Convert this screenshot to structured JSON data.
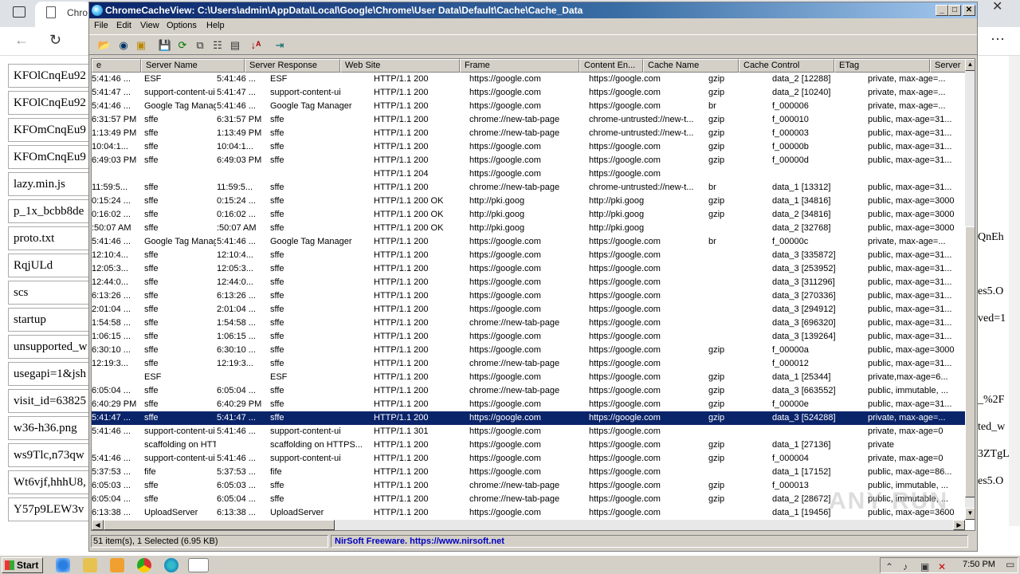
{
  "browser": {
    "tab_title": "Chro"
  },
  "page_left_items": [
    "KFOlCnqEu92",
    "KFOlCnqEu92",
    "KFOmCnqEu9",
    "KFOmCnqEu9",
    "lazy.min.js",
    "p_1x_bcbb8de",
    "proto.txt",
    "RqjULd",
    "scs",
    "startup",
    "unsupported_w",
    "usegapi=1&jsh",
    "visit_id=63825",
    "w36-h36.png",
    "ws9Tlc,n73qw",
    "Wt6vjf,hhhU8,",
    "Y57p9LEW3v"
  ],
  "page_right_items": [
    "",
    "",
    "",
    "",
    "",
    "",
    "QnEh",
    "",
    "es5.O",
    "ved=1",
    "",
    "",
    "_%2F",
    "ted_w",
    "3ZTgL",
    "es5.O",
    ""
  ],
  "app": {
    "title": "ChromeCacheView:  C:\\Users\\admin\\AppData\\Local\\Google\\Chrome\\User Data\\Default\\Cache\\Cache_Data",
    "menu": [
      "File",
      "Edit",
      "View",
      "Options",
      "Help"
    ],
    "columns": [
      "e",
      "Server Name",
      "Server Response",
      "Web Site",
      "Frame",
      "Content En...",
      "Cache Name",
      "Cache Control",
      "ETag",
      "Server"
    ],
    "rows": [
      [
        "5:41:46 ...",
        "ESF",
        "5:41:46 ...",
        "ESF",
        "HTTP/1.1 200",
        "https://google.com",
        "https://google.com",
        "gzip",
        "data_2  [12288]",
        "private, max-age=..."
      ],
      [
        "5:41:47 ...",
        "support-content-ui",
        "5:41:47 ...",
        "support-content-ui",
        "HTTP/1.1 200",
        "https://google.com",
        "https://google.com",
        "gzip",
        "data_2  [10240]",
        "private, max-age=..."
      ],
      [
        "5:41:46 ...",
        "Google Tag Manag",
        "5:41:46 ...",
        "Google Tag Manager",
        "HTTP/1.1 200",
        "https://google.com",
        "https://google.com",
        "br",
        "f_000006",
        "private, max-age=..."
      ],
      [
        "6:31:57 PM",
        "sffe",
        "6:31:57 PM",
        "sffe",
        "HTTP/1.1 200",
        "chrome://new-tab-page",
        "chrome-untrusted://new-t...",
        "gzip",
        "f_000010",
        "public, max-age=31..."
      ],
      [
        "1:13:49 PM",
        "sffe",
        "1:13:49 PM",
        "sffe",
        "HTTP/1.1 200",
        "chrome://new-tab-page",
        "chrome-untrusted://new-t...",
        "gzip",
        "f_000003",
        "public, max-age=31..."
      ],
      [
        "10:04:1...",
        "sffe",
        "10:04:1...",
        "sffe",
        "HTTP/1.1 200",
        "https://google.com",
        "https://google.com",
        "gzip",
        "f_00000b",
        "public, max-age=31..."
      ],
      [
        "6:49:03 PM",
        "sffe",
        "6:49:03 PM",
        "sffe",
        "HTTP/1.1 200",
        "https://google.com",
        "https://google.com",
        "gzip",
        "f_00000d",
        "public, max-age=31..."
      ],
      [
        "",
        "",
        "",
        "",
        "HTTP/1.1 204",
        "https://google.com",
        "https://google.com",
        "",
        "",
        ""
      ],
      [
        "11:59:5...",
        "sffe",
        "11:59:5...",
        "sffe",
        "HTTP/1.1 200",
        "chrome://new-tab-page",
        "chrome-untrusted://new-t...",
        "br",
        "data_1  [13312]",
        "public, max-age=31..."
      ],
      [
        "0:15:24 ...",
        "sffe",
        "0:15:24 ...",
        "sffe",
        "HTTP/1.1 200 OK",
        "http://pki.goog",
        "http://pki.goog",
        "gzip",
        "data_1  [34816]",
        "public, max-age=3000"
      ],
      [
        "0:16:02 ...",
        "sffe",
        "0:16:02 ...",
        "sffe",
        "HTTP/1.1 200 OK",
        "http://pki.goog",
        "http://pki.goog",
        "gzip",
        "data_2  [34816]",
        "public, max-age=3000"
      ],
      [
        ":50:07 AM",
        "sffe",
        ":50:07 AM",
        "sffe",
        "HTTP/1.1 200 OK",
        "http://pki.goog",
        "http://pki.goog",
        "",
        "data_2  [32768]",
        "public, max-age=3000"
      ],
      [
        "5:41:46 ...",
        "Google Tag Manag",
        "5:41:46 ...",
        "Google Tag Manager",
        "HTTP/1.1 200",
        "https://google.com",
        "https://google.com",
        "br",
        "f_00000c",
        "private, max-age=..."
      ],
      [
        "12:10:4...",
        "sffe",
        "12:10:4...",
        "sffe",
        "HTTP/1.1 200",
        "https://google.com",
        "https://google.com",
        "",
        "data_3  [335872]",
        "public, max-age=31..."
      ],
      [
        "12:05:3...",
        "sffe",
        "12:05:3...",
        "sffe",
        "HTTP/1.1 200",
        "https://google.com",
        "https://google.com",
        "",
        "data_3  [253952]",
        "public, max-age=31..."
      ],
      [
        "12:44:0...",
        "sffe",
        "12:44:0...",
        "sffe",
        "HTTP/1.1 200",
        "https://google.com",
        "https://google.com",
        "",
        "data_3  [311296]",
        "public, max-age=31..."
      ],
      [
        "6:13:26 ...",
        "sffe",
        "6:13:26 ...",
        "sffe",
        "HTTP/1.1 200",
        "https://google.com",
        "https://google.com",
        "",
        "data_3  [270336]",
        "public, max-age=31..."
      ],
      [
        "2:01:04 ...",
        "sffe",
        "2:01:04 ...",
        "sffe",
        "HTTP/1.1 200",
        "https://google.com",
        "https://google.com",
        "",
        "data_3  [294912]",
        "public, max-age=31..."
      ],
      [
        "1:54:58 ...",
        "sffe",
        "1:54:58 ...",
        "sffe",
        "HTTP/1.1 200",
        "chrome://new-tab-page",
        "https://google.com",
        "",
        "data_3  [696320]",
        "public, max-age=31..."
      ],
      [
        "1:06:15 ...",
        "sffe",
        "1:06:15 ...",
        "sffe",
        "HTTP/1.1 200",
        "https://google.com",
        "https://google.com",
        "",
        "data_3  [139264]",
        "public, max-age=31..."
      ],
      [
        "6:30:10 ...",
        "sffe",
        "6:30:10 ...",
        "sffe",
        "HTTP/1.1 200",
        "https://google.com",
        "https://google.com",
        "gzip",
        "f_00000a",
        "public, max-age=3000"
      ],
      [
        "12:19:3...",
        "sffe",
        "12:19:3...",
        "sffe",
        "HTTP/1.1 200",
        "chrome://new-tab-page",
        "https://google.com",
        "",
        "f_000012",
        "public, max-age=31..."
      ],
      [
        "",
        "ESF",
        "",
        "ESF",
        "HTTP/1.1 200",
        "https://google.com",
        "https://google.com",
        "gzip",
        "data_1  [25344]",
        "private,max-age=6..."
      ],
      [
        "6:05:04 ...",
        "sffe",
        "6:05:04 ...",
        "sffe",
        "HTTP/1.1 200",
        "chrome://new-tab-page",
        "https://google.com",
        "gzip",
        "data_3  [663552]",
        "public, immutable, ..."
      ],
      [
        "6:40:29 PM",
        "sffe",
        "6:40:29 PM",
        "sffe",
        "HTTP/1.1 200",
        "https://google.com",
        "https://google.com",
        "gzip",
        "f_00000e",
        "public, max-age=31..."
      ],
      [
        "5:41:47 ...",
        "sffe",
        "5:41:47 ...",
        "sffe",
        "HTTP/1.1 200",
        "https://google.com",
        "https://google.com",
        "gzip",
        "data_3  [524288]",
        "private, max-age=..."
      ],
      [
        "5:41:46 ...",
        "support-content-ui",
        "5:41:46 ...",
        "support-content-ui",
        "HTTP/1.1 301",
        "https://google.com",
        "https://google.com",
        "",
        "",
        "private, max-age=0"
      ],
      [
        "",
        "scaffolding on HTTI",
        "",
        "scaffolding on HTTPS...",
        "HTTP/1.1 200",
        "https://google.com",
        "https://google.com",
        "gzip",
        "data_1  [27136]",
        "private"
      ],
      [
        "5:41:46 ...",
        "support-content-ui",
        "5:41:46 ...",
        "support-content-ui",
        "HTTP/1.1 200",
        "https://google.com",
        "https://google.com",
        "gzip",
        "f_000004",
        "private, max-age=0"
      ],
      [
        "5:37:53 ...",
        "fife",
        "5:37:53 ...",
        "fife",
        "HTTP/1.1 200",
        "https://google.com",
        "https://google.com",
        "",
        "data_1  [17152]",
        "public, max-age=86..."
      ],
      [
        "6:05:03 ...",
        "sffe",
        "6:05:03 ...",
        "sffe",
        "HTTP/1.1 200",
        "chrome://new-tab-page",
        "https://google.com",
        "gzip",
        "f_000013",
        "public, immutable, ..."
      ],
      [
        "6:05:04 ...",
        "sffe",
        "6:05:04 ...",
        "sffe",
        "HTTP/1.1 200",
        "chrome://new-tab-page",
        "https://google.com",
        "gzip",
        "data_2  [28672]",
        "public, immutable, ..."
      ],
      [
        "6:13:38 ...",
        "UploadServer",
        "6:13:38 ...",
        "UploadServer",
        "HTTP/1.1 200",
        "https://google.com",
        "https://google.com",
        "",
        "data_1  [19456]",
        "public, max-age=3600"
      ]
    ],
    "selected_row": 25,
    "status_left": "51 item(s), 1 Selected  (6.95 KB)",
    "status_right": "NirSoft Freeware. https://www.nirsoft.net"
  },
  "taskbar": {
    "start_label": "Start",
    "clock": "7:50 PM"
  },
  "watermark": "ANY RUN",
  "colors": {
    "selection": "#0a246a",
    "link_blue": "#0000c0",
    "title_gradient_start": "#0a246a"
  }
}
